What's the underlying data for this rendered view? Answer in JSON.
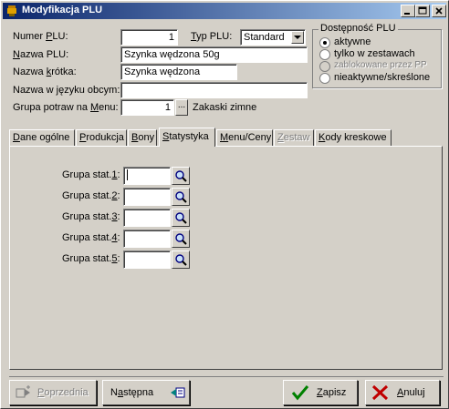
{
  "window": {
    "title": "Modyfikacja PLU",
    "buttons": {
      "minimize": "minimize-icon",
      "maximize": "maximize-icon",
      "close": "close-icon"
    }
  },
  "form": {
    "numer_plu": {
      "label_pre": "Numer ",
      "label_u": "P",
      "label_post": "LU:",
      "value": "1"
    },
    "typ_plu": {
      "label_u": "T",
      "label_post": "yp PLU:",
      "value": "Standard"
    },
    "nazwa_plu": {
      "label_u": "N",
      "label_post": "azwa PLU:",
      "value": "Szynka wędzona 50g"
    },
    "nazwa_krotka": {
      "label_pre": "Nazwa ",
      "label_u": "k",
      "label_post": "rótka:",
      "value": "Szynka wędzona"
    },
    "nazwa_obca": {
      "label": "Nazwa w języku obcym:",
      "value": ""
    },
    "grupa_menu": {
      "label_pre": "Grupa potraw na ",
      "label_u": "M",
      "label_post": "enu:",
      "value": "1",
      "button": "...",
      "name": "Zakaski zimne"
    }
  },
  "availability": {
    "title": "Dostępność PLU",
    "options": [
      {
        "label": "aktywne",
        "checked": true,
        "disabled": false
      },
      {
        "label": "tylko w zestawach",
        "checked": false,
        "disabled": false
      },
      {
        "label": "zablokowane przez PP",
        "checked": false,
        "disabled": true
      },
      {
        "label": "nieaktywne/skreślone",
        "checked": false,
        "disabled": false
      }
    ]
  },
  "tabs": [
    {
      "pre": "",
      "u": "D",
      "post": "ane ogólne",
      "active": false,
      "disabled": false
    },
    {
      "pre": "",
      "u": "P",
      "post": "rodukcja",
      "active": false,
      "disabled": false
    },
    {
      "pre": "",
      "u": "B",
      "post": "ony",
      "active": false,
      "disabled": false
    },
    {
      "pre": "",
      "u": "S",
      "post": "tatystyka",
      "active": true,
      "disabled": false
    },
    {
      "pre": "",
      "u": "M",
      "post": "enu/Ceny",
      "active": false,
      "disabled": false
    },
    {
      "pre": "",
      "u": "Z",
      "post": "estaw",
      "active": false,
      "disabled": true
    },
    {
      "pre": "",
      "u": "K",
      "post": "ody kreskowe",
      "active": false,
      "disabled": false
    }
  ],
  "stat_groups": [
    {
      "label_pre": "Grupa stat.",
      "label_u": "1",
      "label_post": ":",
      "value": ""
    },
    {
      "label_pre": "Grupa stat.",
      "label_u": "2",
      "label_post": ":",
      "value": ""
    },
    {
      "label_pre": "Grupa stat.",
      "label_u": "3",
      "label_post": ":",
      "value": ""
    },
    {
      "label_pre": "Grupa stat.",
      "label_u": "4",
      "label_post": ":",
      "value": ""
    },
    {
      "label_pre": "Grupa stat.",
      "label_u": "5",
      "label_post": ":",
      "value": ""
    }
  ],
  "footer": {
    "previous": {
      "pre": "",
      "u": "P",
      "post": "oprzednia",
      "disabled": true
    },
    "next": {
      "pre": "N",
      "u": "a",
      "post": "stępna",
      "disabled": false
    },
    "save": {
      "pre": "",
      "u": "Z",
      "post": "apisz"
    },
    "cancel": {
      "pre": "",
      "u": "A",
      "post": "nuluj"
    }
  },
  "colors": {
    "titlebar": "#0a246a",
    "face": "#d4d0c8",
    "save_check": "#008000",
    "cancel_x": "#c00000"
  }
}
